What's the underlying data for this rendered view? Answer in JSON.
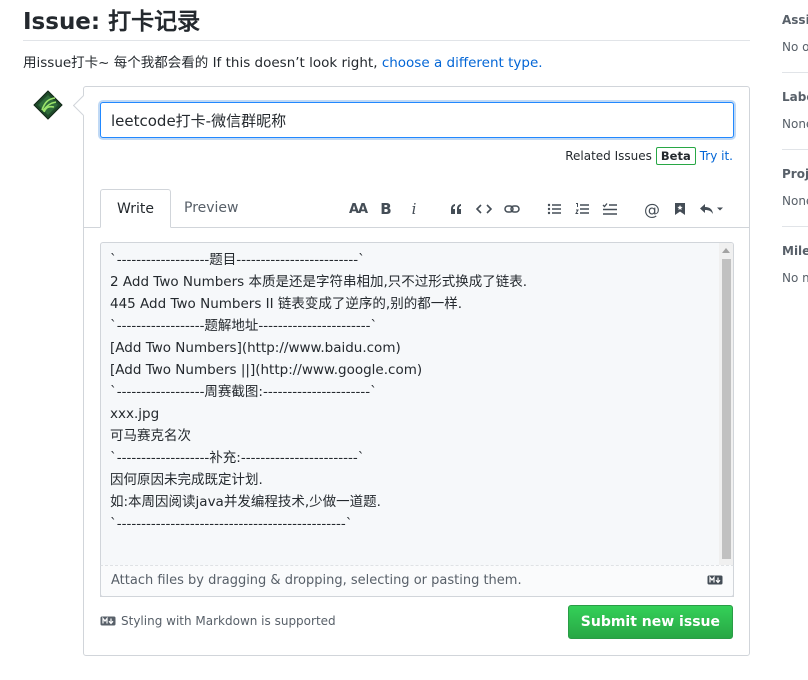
{
  "page": {
    "title": "Issue: 打卡记录",
    "intro_text": "用issue打卡~ 每个我都会看的 If this doesn’t look right, ",
    "intro_link": "choose a different type."
  },
  "form": {
    "title_value": "leetcode打卡-微信群昵称",
    "related_label": "Related Issues",
    "beta_badge": "Beta",
    "try_it": "Try it.",
    "tabs": [
      {
        "label": "Write",
        "active": true
      },
      {
        "label": "Preview",
        "active": false
      }
    ],
    "toolbar": {
      "header_icon": "AA",
      "bold_icon": "B",
      "italic_icon": "i",
      "mention_icon": "@"
    },
    "body_lines": [
      "`-------------------题目-------------------------`",
      "2 Add Two Numbers  本质是还是字符串相加,只不过形式换成了链表.",
      "445 Add Two Numbers II  链表变成了逆序的,别的都一样.",
      "`------------------题解地址-----------------------`",
      "[Add Two Numbers](http://www.baidu.com)",
      "[Add Two Numbers ||](http://www.google.com)",
      "`------------------周赛截图:----------------------`",
      "xxx.jpg",
      "可马赛克名次",
      "`-------------------补充:------------------------`",
      "因何原因未完成既定计划.",
      "如:本周因阅读java并发编程技术,少做一道题.",
      "`-----------------------------------------------`"
    ],
    "attach_text": "Attach files by dragging & dropping, selecting or pasting them.",
    "markdown_note": "Styling with Markdown is supported",
    "submit_label": "Submit new issue"
  },
  "sidebar": {
    "sections": [
      {
        "head": "Assig",
        "value": "No o"
      },
      {
        "head": "Labe",
        "value": "None"
      },
      {
        "head": "Proje",
        "value": "None"
      },
      {
        "head": "Miles",
        "value": "No m"
      }
    ]
  },
  "colors": {
    "accent_link": "#0366d6",
    "submit_green": "#28a745",
    "border": "#d1d5da"
  }
}
